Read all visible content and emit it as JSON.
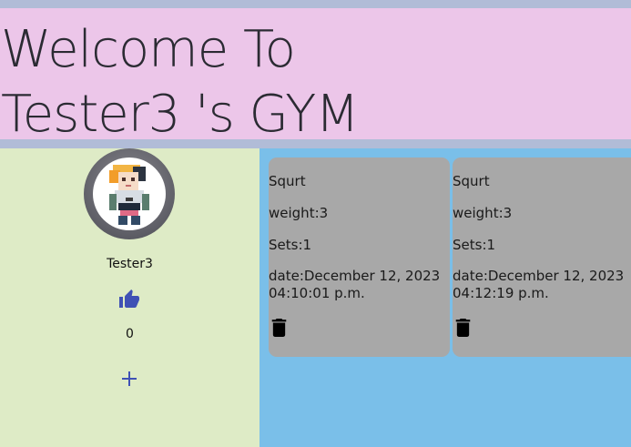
{
  "header": {
    "title": "Welcome To\nTester3 's GYM"
  },
  "profile": {
    "username": "Tester3",
    "likes": "0"
  },
  "icons": {
    "like": "thumbs-up-icon",
    "add": "plus-icon",
    "delete": "trash-icon"
  },
  "colors": {
    "header_bg": "#ecc6e9",
    "sidebar_bg": "#deebc6",
    "main_bg": "#7abfe9",
    "card_bg": "#a8a8a8",
    "accent": "#3f51b5"
  },
  "workouts": [
    {
      "name": "Squrt",
      "weight": "weight:3",
      "sets": "Sets:1",
      "date": "date:December 12, 2023 04:10:01 p.m."
    },
    {
      "name": "Squrt",
      "weight": "weight:3",
      "sets": "Sets:1",
      "date": "date:December 12, 2023 04:12:19 p.m."
    }
  ]
}
